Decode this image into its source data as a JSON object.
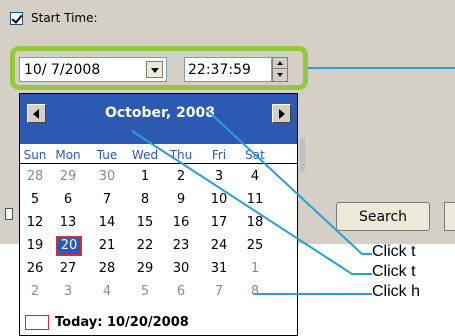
{
  "start_time": {
    "label": "Start Time:",
    "checked": true
  },
  "date_picker": {
    "value": "10/ 7/2008"
  },
  "time_picker": {
    "value": "22:37:59"
  },
  "calendar": {
    "month_title": "October, 2008",
    "weekdays": [
      "Sun",
      "Mon",
      "Tue",
      "Wed",
      "Thu",
      "Fri",
      "Sat"
    ],
    "weeks": [
      [
        "28",
        "29",
        "30",
        "1",
        "2",
        "3",
        "4"
      ],
      [
        "5",
        "6",
        "7",
        "8",
        "9",
        "10",
        "11"
      ],
      [
        "12",
        "13",
        "14",
        "15",
        "16",
        "17",
        "18"
      ],
      [
        "19",
        "20",
        "21",
        "22",
        "23",
        "24",
        "25"
      ],
      [
        "26",
        "27",
        "28",
        "29",
        "30",
        "31",
        "1"
      ],
      [
        "2",
        "3",
        "4",
        "5",
        "6",
        "7",
        "8"
      ]
    ],
    "selected_day": "20",
    "today_label": "Today: 10/20/2008"
  },
  "search_button": {
    "label": "Search"
  },
  "callouts": [
    "Click t",
    "Click t",
    "Click h"
  ],
  "colors": {
    "highlight_border": "#96c83c",
    "calendar_header": "#2c5ab2",
    "callout_line": "#2a9fd6",
    "today_marker": "#d03030"
  }
}
